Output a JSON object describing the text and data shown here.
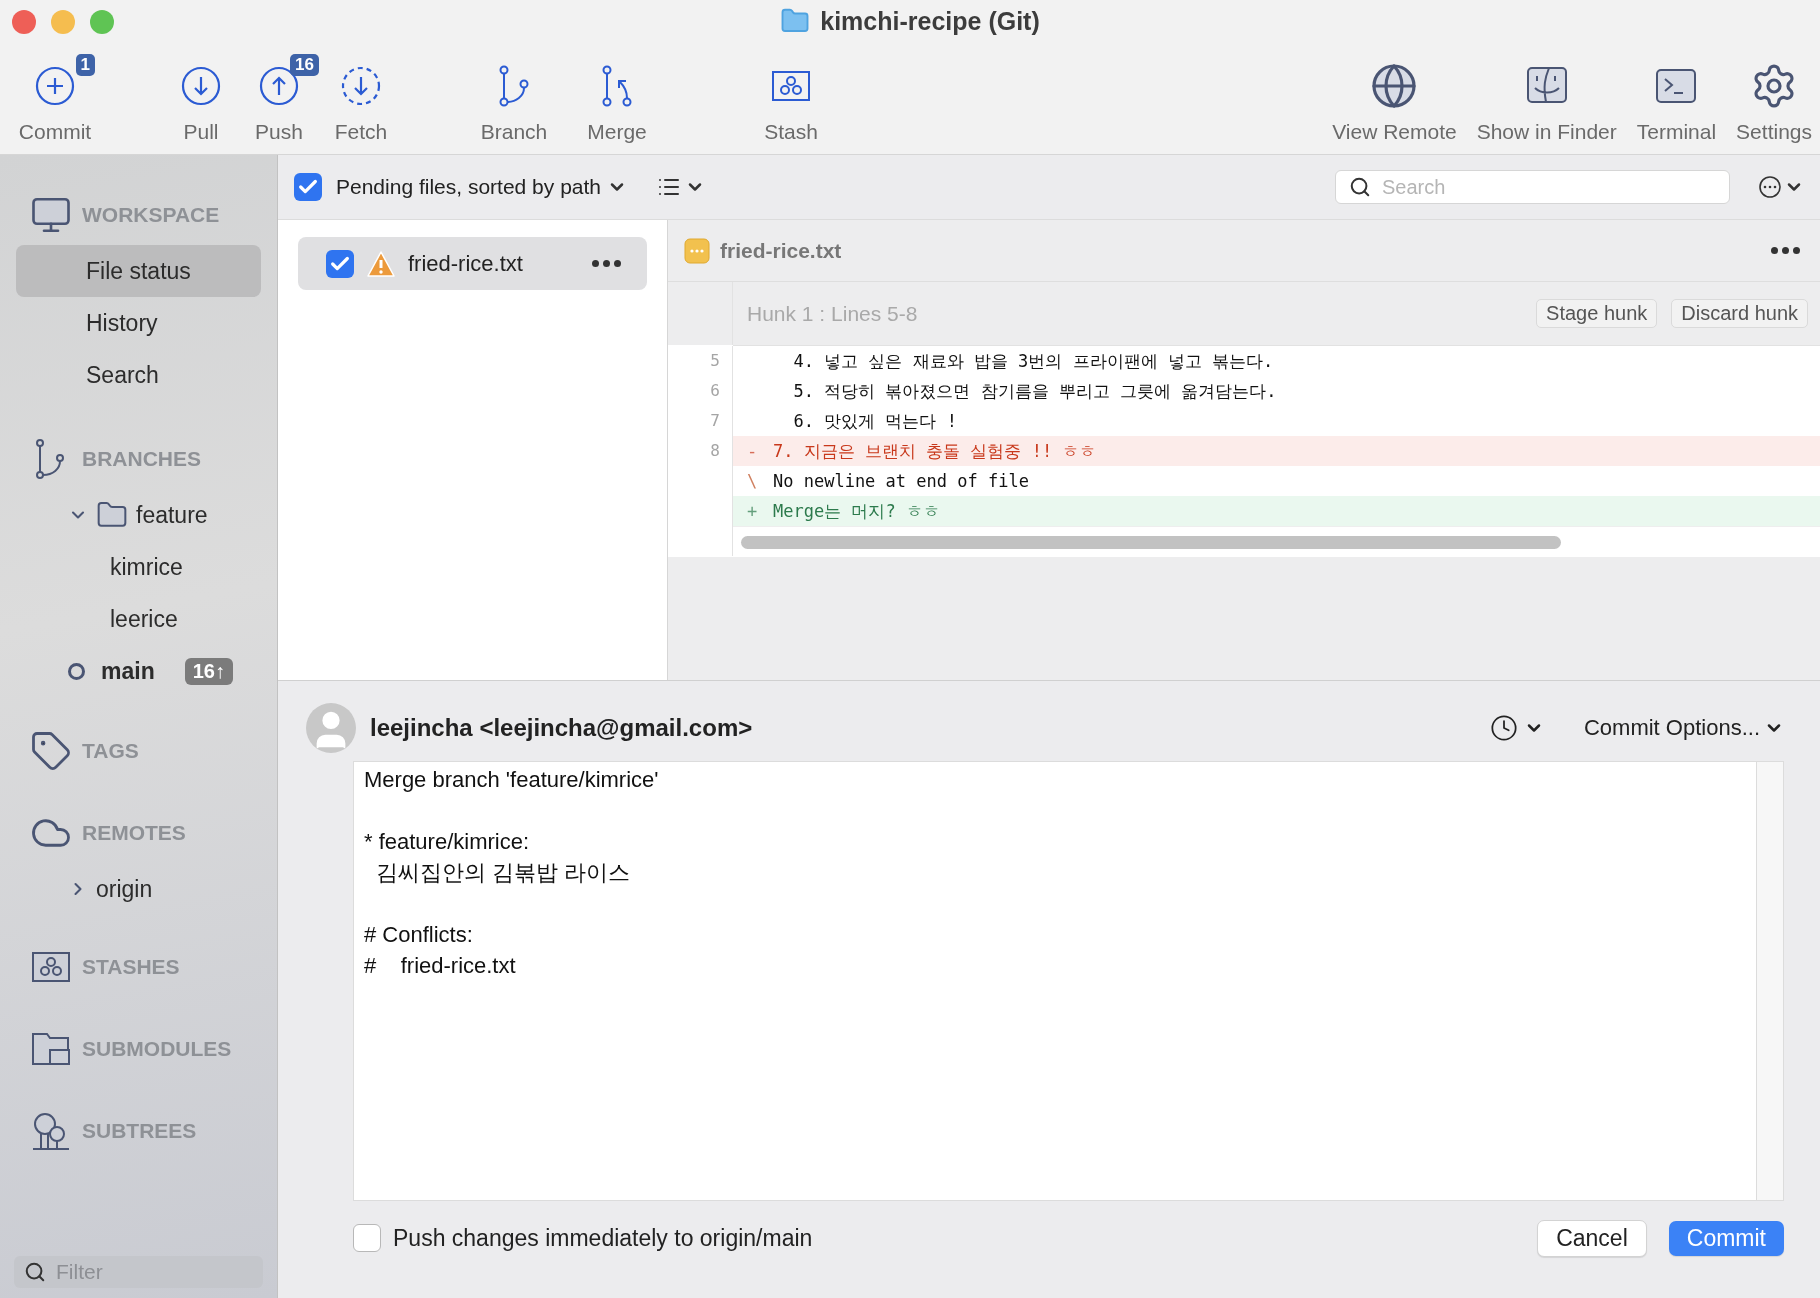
{
  "window": {
    "title": "kimchi-recipe (Git)"
  },
  "toolbar": {
    "left": [
      {
        "kind": "commit",
        "label": "Commit",
        "badge": "1"
      },
      {
        "kind": "pull",
        "label": "Pull"
      },
      {
        "kind": "push",
        "label": "Push",
        "badge": "16"
      },
      {
        "kind": "fetch",
        "label": "Fetch"
      },
      {
        "kind": "branch",
        "label": "Branch"
      },
      {
        "kind": "merge",
        "label": "Merge"
      },
      {
        "kind": "stash",
        "label": "Stash"
      }
    ],
    "right": [
      {
        "kind": "remote",
        "label": "View Remote"
      },
      {
        "kind": "finder",
        "label": "Show in Finder"
      },
      {
        "kind": "terminal",
        "label": "Terminal"
      },
      {
        "kind": "settings",
        "label": "Settings"
      }
    ]
  },
  "sidebar": {
    "sections": [
      {
        "kind": "workspace",
        "title": "WORKSPACE",
        "items": [
          {
            "label": "File status",
            "selected": true
          },
          {
            "label": "History",
            "selected": false
          },
          {
            "label": "Search",
            "selected": false
          }
        ]
      },
      {
        "kind": "branches",
        "title": "BRANCHES",
        "items": [
          {
            "kind": "folder",
            "label": "feature",
            "expanded": true,
            "children": [
              {
                "kind": "branch",
                "label": "kimrice",
                "current": false
              },
              {
                "kind": "branch",
                "label": "leerice",
                "current": false
              }
            ]
          },
          {
            "kind": "branch",
            "label": "main",
            "current": true,
            "badge": "16↑"
          }
        ]
      },
      {
        "kind": "tags",
        "title": "TAGS"
      },
      {
        "kind": "remotes",
        "title": "REMOTES",
        "items": [
          {
            "kind": "folder",
            "label": "origin",
            "expanded": false
          }
        ]
      },
      {
        "kind": "stashes",
        "title": "STASHES"
      },
      {
        "kind": "submodules",
        "title": "SUBMODULES"
      },
      {
        "kind": "subtrees",
        "title": "SUBTREES"
      }
    ],
    "filter": {
      "placeholder": "Filter"
    }
  },
  "file_list": {
    "all_checked": true,
    "sort_label": "Pending files, sorted by path",
    "search": {
      "placeholder": "Search"
    },
    "files": [
      {
        "name": "fried-rice.txt",
        "checked": true,
        "conflicted": true,
        "selected": true
      }
    ]
  },
  "diff": {
    "filename": "fried-rice.txt",
    "hunk": "Hunk 1 : Lines 5-8",
    "buttons": [
      "Stage hunk",
      "Discard hunk"
    ],
    "lines": [
      {
        "kind": "context",
        "num": "5",
        "text": "4. 넣고 싶은 재료와 밥을 3번의 프라이팬에 넣고 볶는다."
      },
      {
        "kind": "context",
        "num": "6",
        "text": "5. 적당히 볶아졌으면 참기름을 뿌리고 그릇에 옮겨담는다."
      },
      {
        "kind": "context",
        "num": "7",
        "text": "6. 맛있게 먹는다 !"
      },
      {
        "kind": "removed",
        "num": "8",
        "marker": "-",
        "text": "7. 지금은 브랜치 충돌 실험중 !! ㅎㅎ"
      },
      {
        "kind": "note",
        "marker": "\\",
        "text": "No newline at end of file"
      },
      {
        "kind": "added",
        "marker": "+",
        "text": "Merge는 머지? ㅎㅎ"
      }
    ]
  },
  "commit": {
    "author": "leejincha <leejincha@gmail.com>",
    "options_label": "Commit Options...",
    "message": "Merge branch 'feature/kimrice'\n\n* feature/kimrice:\n  김씨집안의 김볶밥 라이스\n\n# Conflicts:\n#\tfried-rice.txt\n",
    "push": {
      "label": "Push changes immediately to origin/main",
      "checked": false
    },
    "buttons": [
      {
        "label": "Cancel",
        "primary": false
      },
      {
        "label": "Commit",
        "primary": true
      }
    ]
  }
}
